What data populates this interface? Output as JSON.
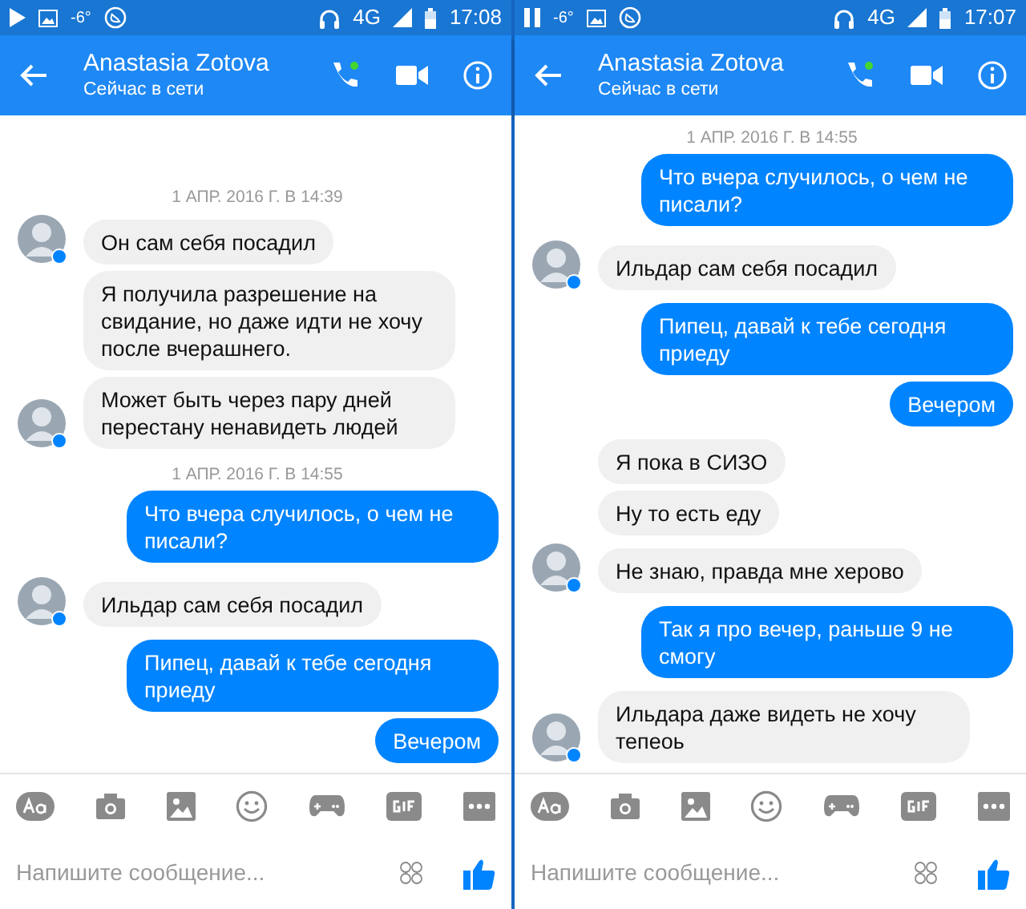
{
  "screens": [
    {
      "status_bar": {
        "left": [
          {
            "kind": "play"
          },
          {
            "kind": "image"
          },
          {
            "kind": "temp",
            "text": "-6°"
          },
          {
            "kind": "call"
          }
        ],
        "network": "4G",
        "time": "17:08"
      },
      "header": {
        "name": "Anastasia Zotova",
        "status": "Сейчас в сети",
        "online": true
      },
      "messages": [
        {
          "kind": "timestamp",
          "text": "1 АПР. 2016 Г. В 14:39"
        },
        {
          "kind": "incoming",
          "text": "Он сам себя посадил",
          "avatar": true
        },
        {
          "kind": "incoming",
          "text": "Я получила разрешение на свидание, но даже идти не хочу после вчерашнего.",
          "avatar": false
        },
        {
          "kind": "incoming",
          "text": "Может быть через пару дней перестану ненавидеть людей",
          "avatar": true
        },
        {
          "kind": "timestamp",
          "text": "1 АПР. 2016 Г. В 14:55"
        },
        {
          "kind": "outgoing",
          "text": "Что вчера случилось, о чем не писали?"
        },
        {
          "kind": "incoming",
          "text": "Ильдар сам себя посадил",
          "avatar": true
        },
        {
          "kind": "outgoing",
          "text": "Пипец, давай к тебе сегодня приеду"
        },
        {
          "kind": "outgoing",
          "text": "Вечером"
        }
      ],
      "composer": {
        "placeholder": "Напишите сообщение..."
      }
    },
    {
      "status_bar": {
        "left": [
          {
            "kind": "pause"
          },
          {
            "kind": "temp",
            "text": "-6°"
          },
          {
            "kind": "image"
          },
          {
            "kind": "call"
          }
        ],
        "network": "4G",
        "time": "17:07"
      },
      "header": {
        "name": "Anastasia Zotova",
        "status": "Сейчас в сети",
        "online": true
      },
      "messages": [
        {
          "kind": "timestamp",
          "text": "1 АПР. 2016 Г. В 14:55"
        },
        {
          "kind": "outgoing",
          "text": "Что вчера случилось, о чем не писали?"
        },
        {
          "kind": "incoming",
          "text": "Ильдар сам себя посадил",
          "avatar": true
        },
        {
          "kind": "outgoing",
          "text": "Пипец, давай к тебе сегодня приеду"
        },
        {
          "kind": "outgoing",
          "text": "Вечером"
        },
        {
          "kind": "incoming",
          "text": "Я пока в СИЗО",
          "avatar": false
        },
        {
          "kind": "incoming",
          "text": "Ну то есть еду",
          "avatar": false
        },
        {
          "kind": "incoming",
          "text": "Не знаю, правда мне херово",
          "avatar": true
        },
        {
          "kind": "outgoing",
          "text": "Так я про вечер, раньше 9 не смогу"
        },
        {
          "kind": "incoming",
          "text": "Ильдара даже видеть не хочу тепеоь",
          "avatar": true
        }
      ],
      "composer": {
        "placeholder": "Напишите сообщение..."
      }
    }
  ]
}
